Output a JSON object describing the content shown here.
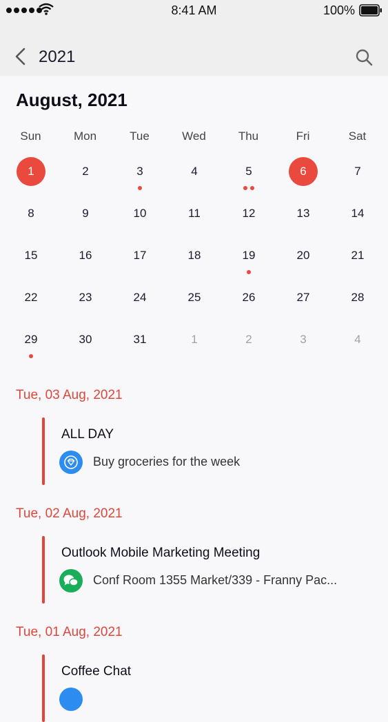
{
  "status": {
    "time": "8:41 AM",
    "battery": "100%"
  },
  "nav": {
    "title": "2021"
  },
  "month_label": "August, 2021",
  "weekdays": [
    "Sun",
    "Mon",
    "Tue",
    "Wed",
    "Thu",
    "Fri",
    "Sat"
  ],
  "days": [
    {
      "d": "1",
      "selected": true,
      "dots": 0,
      "muted": false
    },
    {
      "d": "2",
      "selected": false,
      "dots": 0,
      "muted": false
    },
    {
      "d": "3",
      "selected": false,
      "dots": 1,
      "muted": false
    },
    {
      "d": "4",
      "selected": false,
      "dots": 0,
      "muted": false
    },
    {
      "d": "5",
      "selected": false,
      "dots": 2,
      "muted": false
    },
    {
      "d": "6",
      "selected": true,
      "dots": 0,
      "muted": false
    },
    {
      "d": "7",
      "selected": false,
      "dots": 0,
      "muted": false
    },
    {
      "d": "8",
      "selected": false,
      "dots": 0,
      "muted": false
    },
    {
      "d": "9",
      "selected": false,
      "dots": 0,
      "muted": false
    },
    {
      "d": "10",
      "selected": false,
      "dots": 0,
      "muted": false
    },
    {
      "d": "11",
      "selected": false,
      "dots": 0,
      "muted": false
    },
    {
      "d": "12",
      "selected": false,
      "dots": 0,
      "muted": false
    },
    {
      "d": "13",
      "selected": false,
      "dots": 0,
      "muted": false
    },
    {
      "d": "14",
      "selected": false,
      "dots": 0,
      "muted": false
    },
    {
      "d": "15",
      "selected": false,
      "dots": 0,
      "muted": false
    },
    {
      "d": "16",
      "selected": false,
      "dots": 0,
      "muted": false
    },
    {
      "d": "17",
      "selected": false,
      "dots": 0,
      "muted": false
    },
    {
      "d": "18",
      "selected": false,
      "dots": 0,
      "muted": false
    },
    {
      "d": "19",
      "selected": false,
      "dots": 1,
      "muted": false
    },
    {
      "d": "20",
      "selected": false,
      "dots": 0,
      "muted": false
    },
    {
      "d": "21",
      "selected": false,
      "dots": 0,
      "muted": false
    },
    {
      "d": "22",
      "selected": false,
      "dots": 0,
      "muted": false
    },
    {
      "d": "23",
      "selected": false,
      "dots": 0,
      "muted": false
    },
    {
      "d": "24",
      "selected": false,
      "dots": 0,
      "muted": false
    },
    {
      "d": "25",
      "selected": false,
      "dots": 0,
      "muted": false
    },
    {
      "d": "26",
      "selected": false,
      "dots": 0,
      "muted": false
    },
    {
      "d": "27",
      "selected": false,
      "dots": 0,
      "muted": false
    },
    {
      "d": "28",
      "selected": false,
      "dots": 0,
      "muted": false
    },
    {
      "d": "29",
      "selected": false,
      "dots": 1,
      "muted": false
    },
    {
      "d": "30",
      "selected": false,
      "dots": 0,
      "muted": false
    },
    {
      "d": "31",
      "selected": false,
      "dots": 0,
      "muted": false
    },
    {
      "d": "1",
      "selected": false,
      "dots": 0,
      "muted": true
    },
    {
      "d": "2",
      "selected": false,
      "dots": 0,
      "muted": true
    },
    {
      "d": "3",
      "selected": false,
      "dots": 0,
      "muted": true
    },
    {
      "d": "4",
      "selected": false,
      "dots": 0,
      "muted": true
    }
  ],
  "agenda": [
    {
      "date": "Tue, 03 Aug, 2021",
      "title": "ALL DAY",
      "subtitle": "Buy groceries for the week",
      "icon": "diamond-icon",
      "icon_color": "#2d8cf0"
    },
    {
      "date": "Tue, 02 Aug, 2021",
      "title": "Outlook Mobile Marketing Meeting",
      "subtitle": "Conf Room 1355 Market/339 - Franny Pac...",
      "icon": "chat-bubbles-icon",
      "icon_color": "#1aad5a"
    },
    {
      "date": "Tue, 01 Aug, 2021",
      "title": "Coffee Chat",
      "subtitle": "",
      "icon": "diamond-icon",
      "icon_color": "#2d8cf0"
    }
  ],
  "colors": {
    "accent": "#e0453a",
    "selected_fill": "#ea4a3e",
    "header_bg": "#efeff0"
  }
}
